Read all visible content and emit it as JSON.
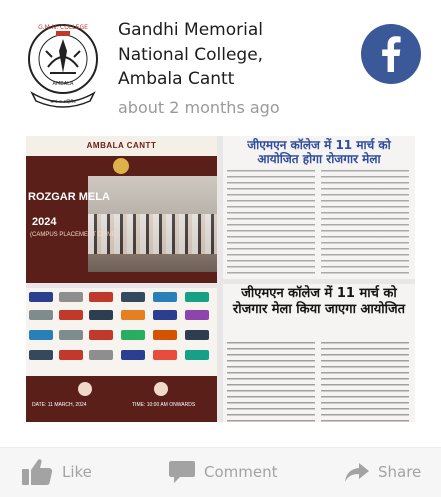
{
  "post": {
    "author": "Gandhi Memorial National College, Ambala Cantt",
    "timestamp": "about 2 months ago",
    "logo_text_top": "G.M.N. COLLEGE",
    "logo_text_sub": "AMBALA",
    "logo_text_bottom": "सत्यं च अहिंसैव"
  },
  "gallery": {
    "poster1": {
      "header": "AMBALA CANTT",
      "line1": "ROZGAR MELA",
      "line2": "2024",
      "line3": "(CAMPUS PLACEMENT DRIVE)"
    },
    "news1": {
      "headline": "जीएमएन कॉलेज में 11 मार्च को आयोजित होगा रोजगार मेला"
    },
    "poster2": {
      "date": "DATE: 11 MARCH, 2024",
      "time": "TIME: 10:00 AM ONWARDS"
    },
    "news2": {
      "headline": "जीएमएन कॉलेज में 11 मार्च को रोजगार मेला किया जाएगा आयोजित"
    }
  },
  "actions": {
    "like": "Like",
    "comment": "Comment",
    "share": "Share"
  },
  "colors": {
    "facebook_blue": "#3b5998",
    "action_gray": "#a3a3a3",
    "poster_maroon": "#5b1f1a",
    "headline_blue": "#2f4c9e"
  },
  "icons": {
    "facebook": "facebook-icon",
    "like": "thumbs-up-icon",
    "comment": "speech-bubble-icon",
    "share": "share-arrow-icon"
  }
}
